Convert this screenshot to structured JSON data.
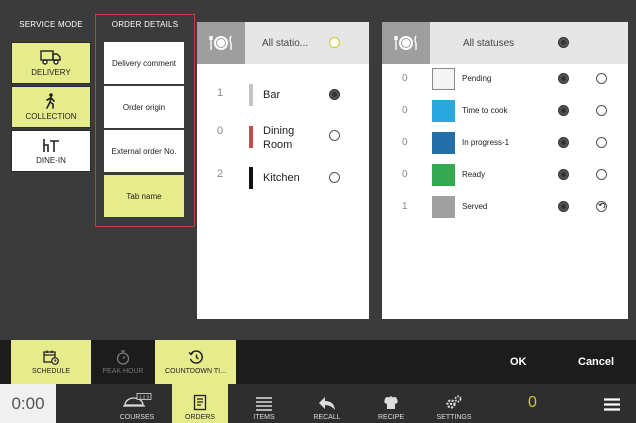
{
  "service_mode": {
    "title": "SERVICE MODE",
    "items": [
      {
        "label": "DELIVERY"
      },
      {
        "label": "COLLECTION"
      },
      {
        "label": "DINE-IN"
      }
    ]
  },
  "order_details": {
    "title": "ORDER DETAILS",
    "items": [
      {
        "label": "Delivery comment"
      },
      {
        "label": "Order origin"
      },
      {
        "label": "External order No."
      },
      {
        "label": "Tab name"
      }
    ]
  },
  "stations": {
    "header": "All statio...",
    "rows": [
      {
        "count": "1",
        "name": "Bar",
        "color": "#c4c4c4",
        "selected": true
      },
      {
        "count": "0",
        "name": "Dining Room",
        "color": "#c94a4a",
        "selected": false
      },
      {
        "count": "2",
        "name": "Kitchen",
        "color": "#111111",
        "selected": false
      }
    ]
  },
  "statuses": {
    "header": "All statuses",
    "rows": [
      {
        "count": "0",
        "name": "Pending",
        "color": "#f4f4f4"
      },
      {
        "count": "0",
        "name": "Time to cook",
        "color": "#2aa7df"
      },
      {
        "count": "0",
        "name": "In progress-1",
        "color": "#236ea6"
      },
      {
        "count": "0",
        "name": "Ready",
        "color": "#35a852"
      },
      {
        "count": "1",
        "name": "Served",
        "color": "#a0a0a0"
      }
    ]
  },
  "action_bar": {
    "schedule": "SCHEDULE",
    "peak_hour": "PEAK HOUR",
    "countdown": "COUNTDOWN TI...",
    "ok": "OK",
    "cancel": "Cancel"
  },
  "footer": {
    "timer": "0:00",
    "courses_badge": "1 2 3",
    "nav": [
      "COURSES",
      "ORDERS",
      "ITEMS",
      "RECALL",
      "RECIPE",
      "SETTINGS"
    ],
    "counter": "0"
  },
  "colors": {
    "accent_yellow": "#e6eb8c",
    "order_details_border": "#c2403d",
    "background": "#3b3b3b"
  }
}
